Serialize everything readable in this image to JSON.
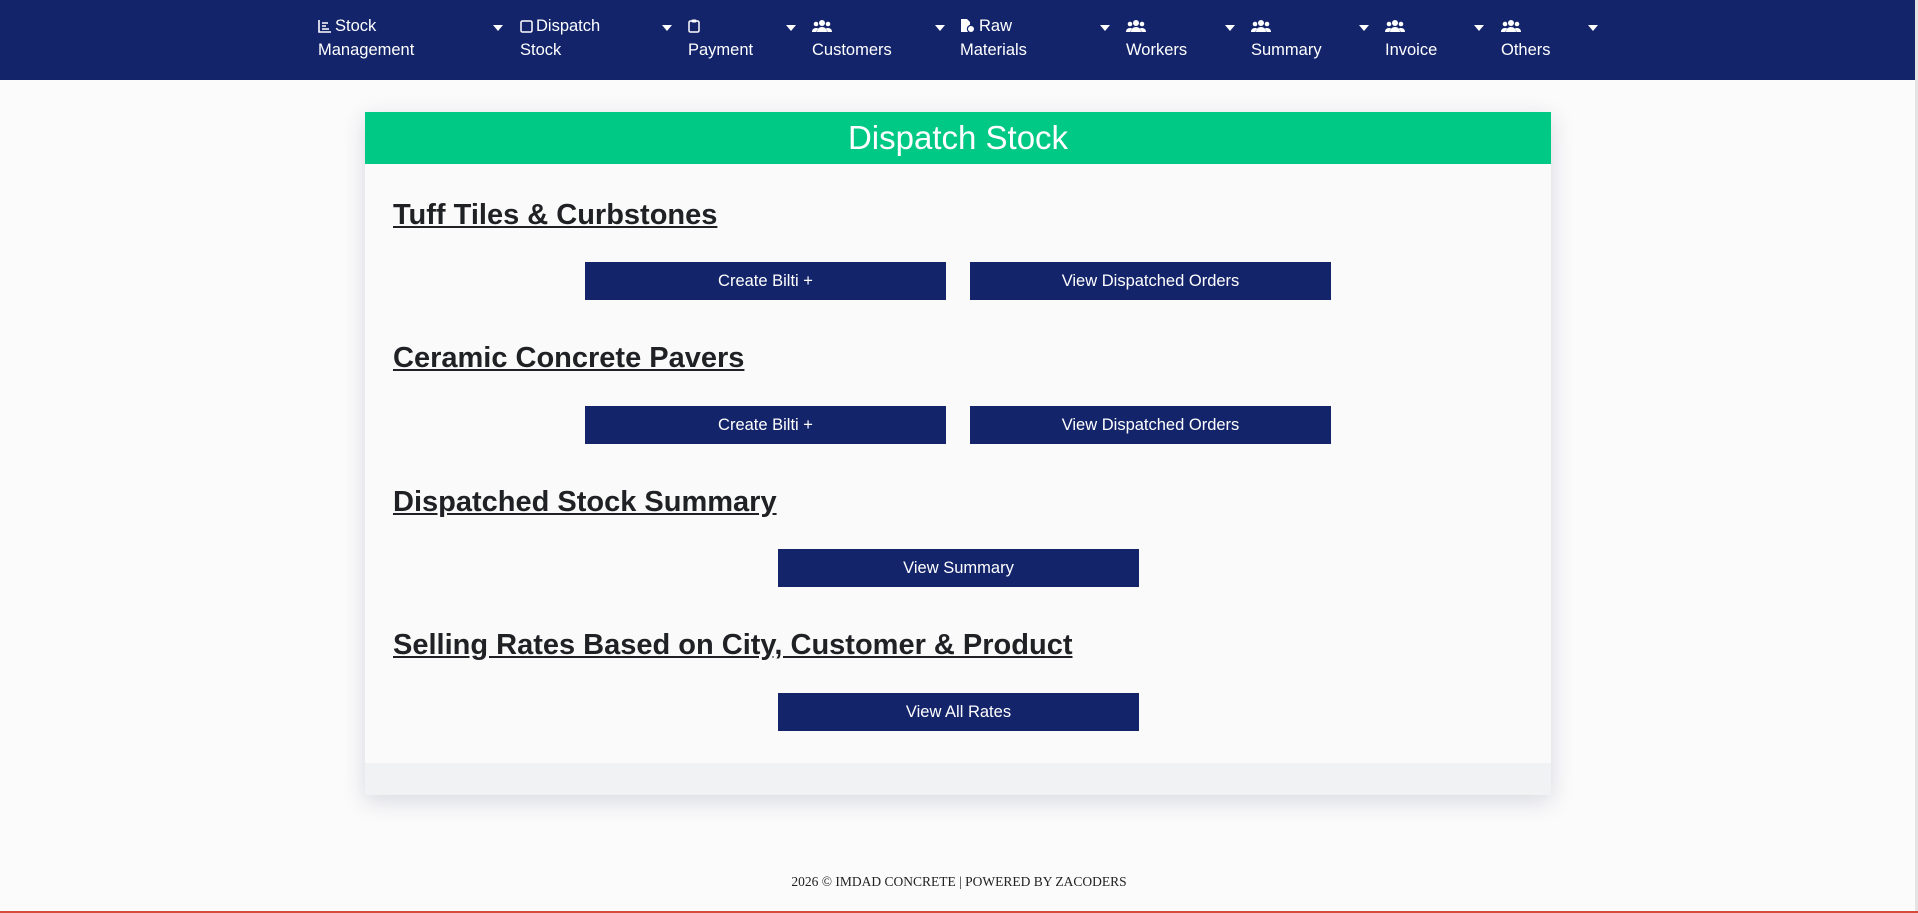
{
  "nav": {
    "items": [
      {
        "line1": "Stock",
        "line2": "Management",
        "icon": "chart-icon"
      },
      {
        "line1": "Dispatch",
        "line2": "Stock",
        "icon": "square-icon"
      },
      {
        "line1": "",
        "line2": "Payment",
        "icon": "clipboard-icon"
      },
      {
        "line1": "",
        "line2": "Customers",
        "icon": "users-icon"
      },
      {
        "line1": "Raw",
        "line2": "Materials",
        "icon": "file-icon"
      },
      {
        "line1": "",
        "line2": "Workers",
        "icon": "users-icon"
      },
      {
        "line1": "",
        "line2": "Summary",
        "icon": "users-icon"
      },
      {
        "line1": "",
        "line2": "Invoice",
        "icon": "users-icon"
      },
      {
        "line1": "",
        "line2": "Others",
        "icon": "users-icon"
      }
    ]
  },
  "card": {
    "title": "Dispatch Stock",
    "sections": [
      {
        "title": "Tuff Tiles & Curbstones",
        "buttons": [
          "Create Bilti +",
          "View Dispatched Orders"
        ]
      },
      {
        "title": "Ceramic Concrete Pavers",
        "buttons": [
          "Create Bilti +",
          "View Dispatched Orders"
        ]
      },
      {
        "title": "Dispatched Stock Summary",
        "buttons": [
          "View Summary"
        ]
      },
      {
        "title": "Selling Rates Based on City, Customer & Product",
        "buttons": [
          "View All Rates"
        ]
      }
    ]
  },
  "footer": {
    "text": "2026 © IMDAD CONCRETE | POWERED BY ZACODERS"
  },
  "colors": {
    "navbar": "#13246b",
    "header": "#00c985",
    "button": "#13246b"
  }
}
